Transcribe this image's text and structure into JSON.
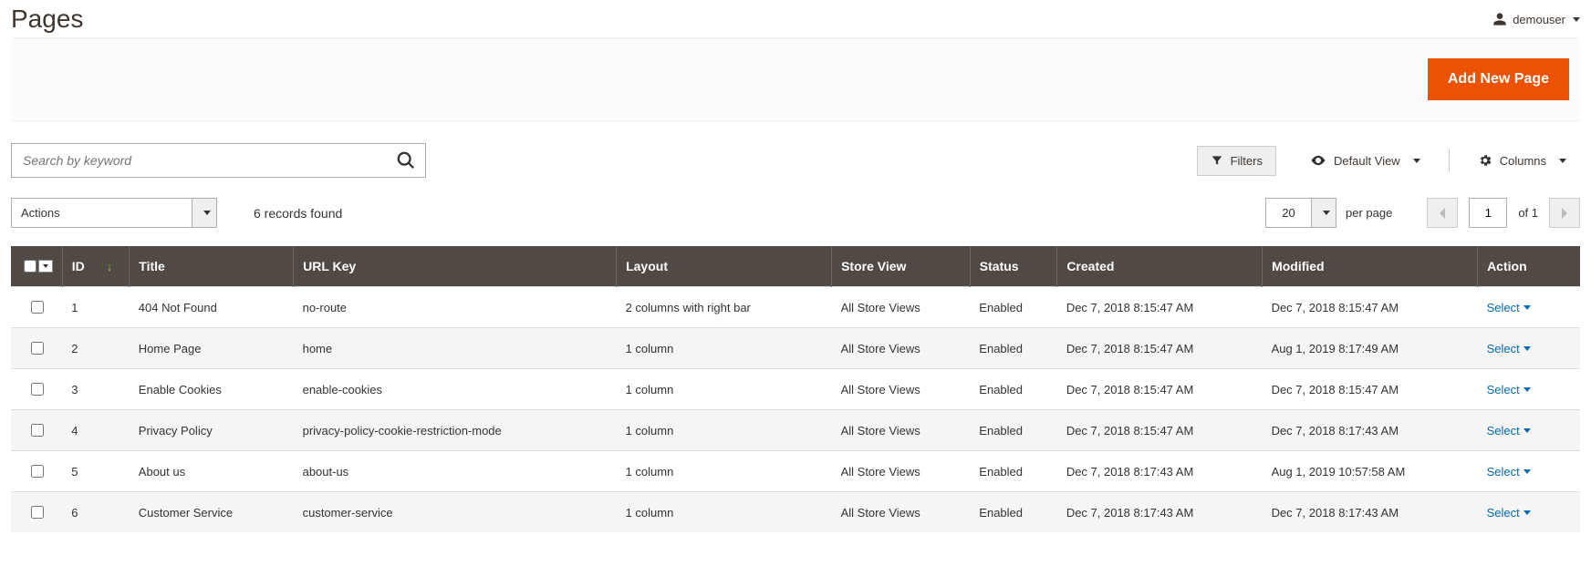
{
  "header": {
    "title": "Pages",
    "user": "demouser",
    "add_button": "Add New Page"
  },
  "search": {
    "placeholder": "Search by keyword"
  },
  "toolbar": {
    "filters": "Filters",
    "default_view": "Default View",
    "columns": "Columns"
  },
  "actions": {
    "label": "Actions",
    "records_found": "6 records found",
    "per_page_value": "20",
    "per_page_label": "per page",
    "current_page": "1",
    "of_label": "of 1"
  },
  "columns": {
    "id": "ID",
    "title": "Title",
    "url_key": "URL Key",
    "layout": "Layout",
    "store_view": "Store View",
    "status": "Status",
    "created": "Created",
    "modified": "Modified",
    "action": "Action"
  },
  "action_label": "Select",
  "rows": [
    {
      "id": "1",
      "title": "404 Not Found",
      "url_key": "no-route",
      "layout": "2 columns with right bar",
      "store_view": "All Store Views",
      "status": "Enabled",
      "created": "Dec 7, 2018 8:15:47 AM",
      "modified": "Dec 7, 2018 8:15:47 AM"
    },
    {
      "id": "2",
      "title": "Home Page",
      "url_key": "home",
      "layout": "1 column",
      "store_view": "All Store Views",
      "status": "Enabled",
      "created": "Dec 7, 2018 8:15:47 AM",
      "modified": "Aug 1, 2019 8:17:49 AM"
    },
    {
      "id": "3",
      "title": "Enable Cookies",
      "url_key": "enable-cookies",
      "layout": "1 column",
      "store_view": "All Store Views",
      "status": "Enabled",
      "created": "Dec 7, 2018 8:15:47 AM",
      "modified": "Dec 7, 2018 8:15:47 AM"
    },
    {
      "id": "4",
      "title": "Privacy Policy",
      "url_key": "privacy-policy-cookie-restriction-mode",
      "layout": "1 column",
      "store_view": "All Store Views",
      "status": "Enabled",
      "created": "Dec 7, 2018 8:15:47 AM",
      "modified": "Dec 7, 2018 8:17:43 AM"
    },
    {
      "id": "5",
      "title": "About us",
      "url_key": "about-us",
      "layout": "1 column",
      "store_view": "All Store Views",
      "status": "Enabled",
      "created": "Dec 7, 2018 8:17:43 AM",
      "modified": "Aug 1, 2019 10:57:58 AM"
    },
    {
      "id": "6",
      "title": "Customer Service",
      "url_key": "customer-service",
      "layout": "1 column",
      "store_view": "All Store Views",
      "status": "Enabled",
      "created": "Dec 7, 2018 8:17:43 AM",
      "modified": "Dec 7, 2018 8:17:43 AM"
    }
  ]
}
